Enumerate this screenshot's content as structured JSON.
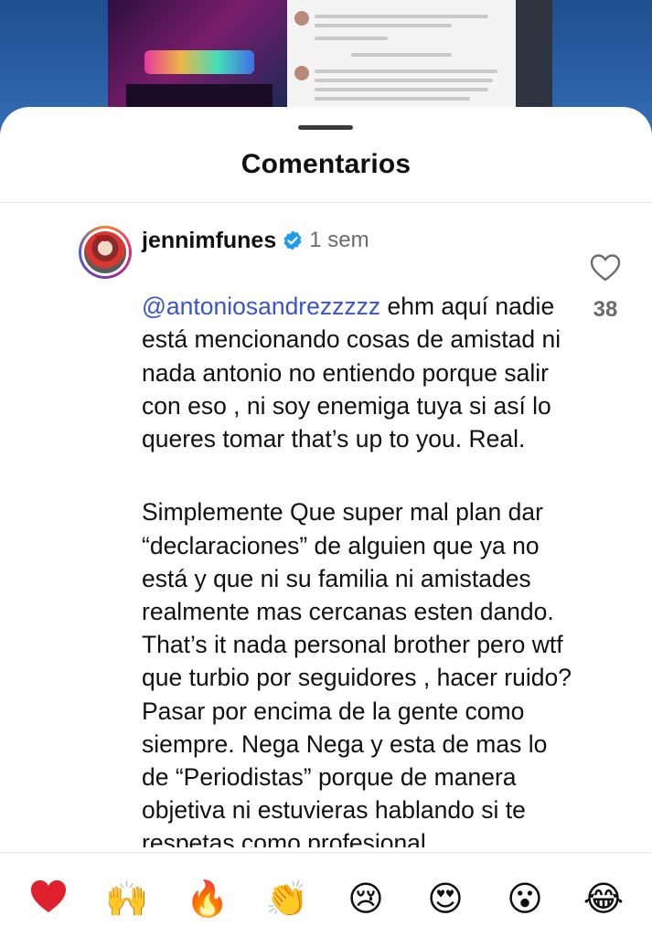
{
  "sheet": {
    "title": "Comentarios"
  },
  "comment": {
    "username": "jennimfunes",
    "time": "1 sem",
    "mention": "@antoniosandrezzzzz",
    "text_part1": " ehm aquí nadie está mencionando cosas de amistad ni nada antonio no entiendo porque salir con eso , ni soy enemiga tuya si así lo queres tomar that’s up to you. Real.",
    "text_part2": "Simplemente Que super mal plan dar “declaraciones” de alguien que ya no está y que ni su familia ni amistades realmente mas cercanas esten dando. That’s it nada personal brother pero wtf que turbio por seguidores , hacer ruido? Pasar por encima de la gente como siempre. Nega Nega y esta de mas lo de “Periodistas” porque de manera objetiva ni estuvieras hablando si te respetas como profesional",
    "likes": "38",
    "avatar_tag": "XV"
  },
  "reactions": [
    {
      "name": "red-heart",
      "glyph": "❤️"
    },
    {
      "name": "raising-hands",
      "glyph": "🙌"
    },
    {
      "name": "fire",
      "glyph": "🔥"
    },
    {
      "name": "clapping-hands",
      "glyph": "👏"
    },
    {
      "name": "crying-face",
      "glyph": "😢"
    },
    {
      "name": "heart-eyes",
      "glyph": "😍"
    },
    {
      "name": "astonished-face",
      "glyph": "😮"
    },
    {
      "name": "tears-of-joy",
      "glyph": "😂"
    }
  ],
  "colors": {
    "mention": "#3a55c6",
    "verified": "#1d9bf0",
    "muted": "#6b6b6b"
  }
}
